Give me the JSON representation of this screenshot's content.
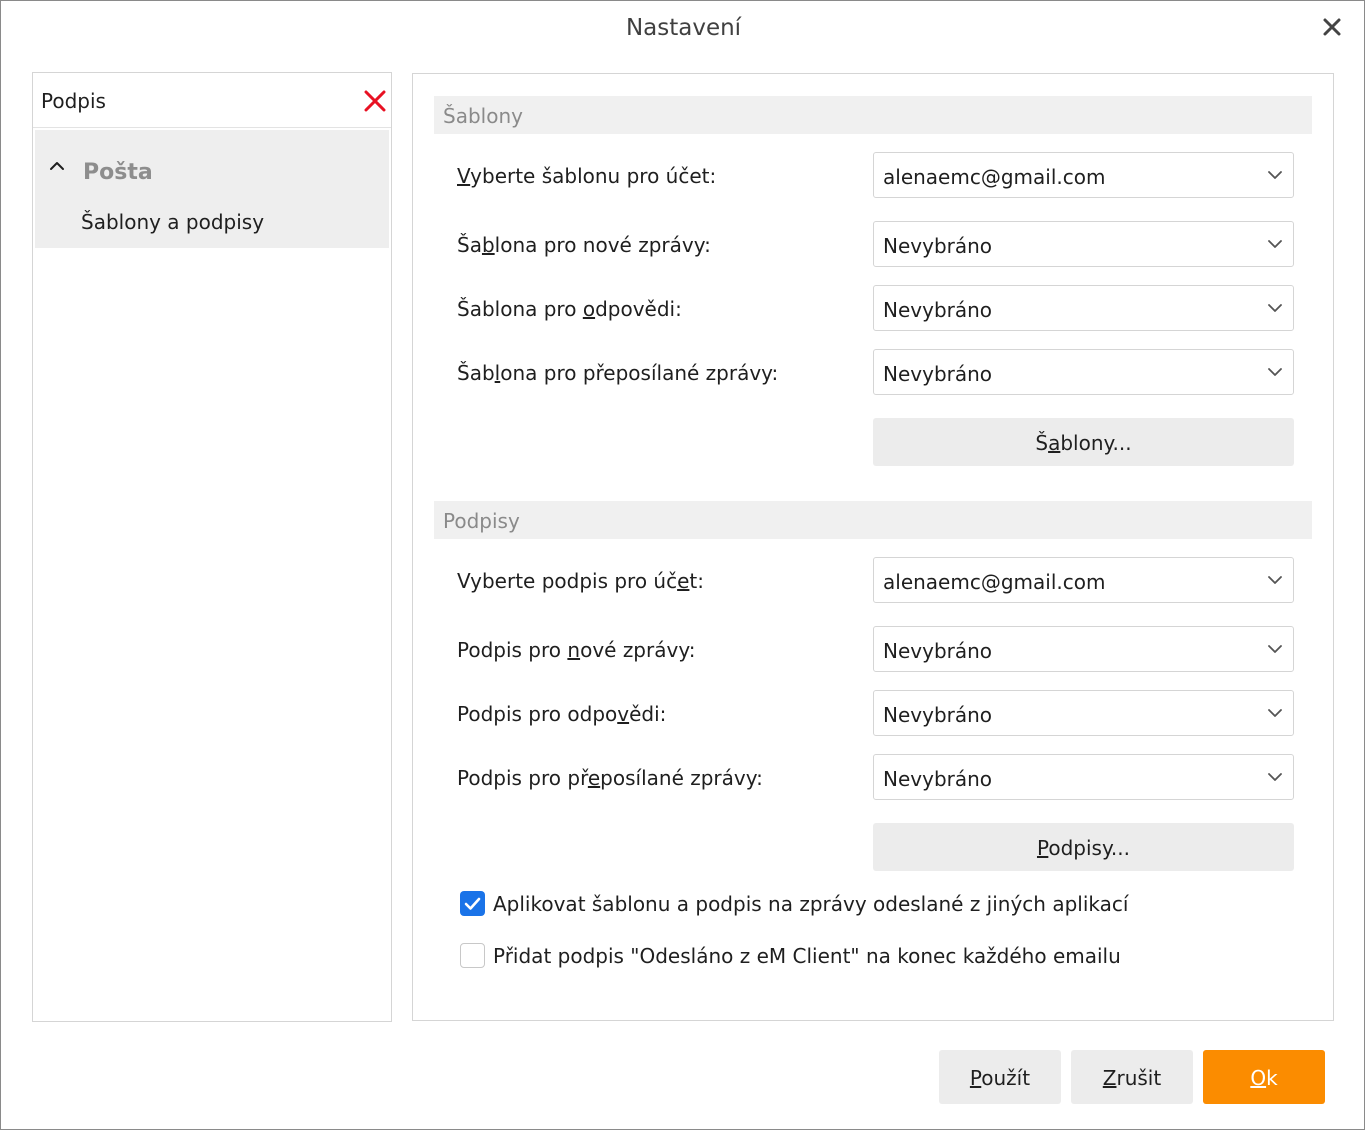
{
  "dialog": {
    "title": "Nastavení"
  },
  "search": {
    "value": "Podpis"
  },
  "tree": {
    "group_label": "Pošta",
    "item_label": "Šablony a podpisy"
  },
  "templates": {
    "header": "Šablony",
    "account_label_pre": "",
    "account_label_u": "V",
    "account_label_post": "yberte šablonu pro účet:",
    "account_value": "alenaemc@gmail.com",
    "new_label_pre": "Ša",
    "new_label_u": "b",
    "new_label_post": "lona pro nové zprávy:",
    "new_value": "Nevybráno",
    "reply_label_pre": "Šablona pro ",
    "reply_label_u": "o",
    "reply_label_post": "dpovědi:",
    "reply_value": "Nevybráno",
    "forward_label_pre": "Šab",
    "forward_label_u": "l",
    "forward_label_post": "ona pro přeposílané zprávy:",
    "forward_value": "Nevybráno",
    "button_pre": "Š",
    "button_u": "a",
    "button_post": "blony..."
  },
  "signatures": {
    "header": "Podpisy",
    "account_label_pre": "Vyberte podpis pro úč",
    "account_label_u": "e",
    "account_label_post": "t:",
    "account_value": "alenaemc@gmail.com",
    "new_label_pre": "Podpis pro ",
    "new_label_u": "n",
    "new_label_post": "ové zprávy:",
    "new_value": "Nevybráno",
    "reply_label_pre": "Podpis pro odpo",
    "reply_label_u": "v",
    "reply_label_post": "ědi:",
    "reply_value": "Nevybráno",
    "forward_label_pre": "Podpis pro př",
    "forward_label_u": "e",
    "forward_label_post": "posílané zprávy:",
    "forward_value": "Nevybráno",
    "button_pre": "",
    "button_u": "P",
    "button_post": "odpisy..."
  },
  "options": {
    "apply_label": "Aplikovat šablonu a podpis na zprávy odeslané z jiných aplikací",
    "apply_checked": true,
    "sent_from_label": "Přidat podpis \"Odesláno z eM Client\" na konec každého emailu",
    "sent_from_checked": false
  },
  "footer": {
    "apply_pre": "",
    "apply_u": "P",
    "apply_post": "oužít",
    "cancel_pre": "",
    "cancel_u": "Z",
    "cancel_post": "rušit",
    "ok_pre": "",
    "ok_u": "O",
    "ok_post": "k"
  },
  "colors": {
    "accent_orange": "#fb8c00",
    "checkbox_blue": "#1a73e8",
    "clear_red": "#e81123"
  }
}
